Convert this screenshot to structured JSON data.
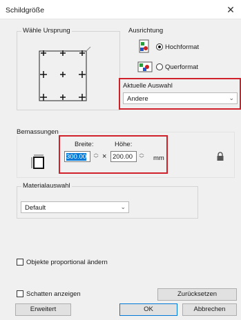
{
  "window": {
    "title": "Schildgröße",
    "close_glyph": "✕"
  },
  "origin": {
    "label": "Wähle Ursprung"
  },
  "orientation": {
    "label": "Ausrichtung",
    "portrait_label": "Hochformat",
    "landscape_label": "Querformat",
    "selected": "Hochformat"
  },
  "current_selection": {
    "label": "Aktuelle Auswahl",
    "value": "Andere"
  },
  "dimensions": {
    "label": "Bemassungen",
    "width_label": "Breite:",
    "width_value": "300.00",
    "times": "×",
    "height_label": "Höhe:",
    "height_value": "200.00",
    "unit": "mm"
  },
  "material": {
    "label": "Materialauswahl",
    "value": "Default"
  },
  "proportional": {
    "label": "Objekte proportional ändern",
    "checked": false
  },
  "shadow": {
    "label": "Schatten anzeigen",
    "checked": false
  },
  "buttons": {
    "reset": "Zurücksetzen",
    "advanced": "Erweitert",
    "ok": "OK",
    "cancel": "Abbrechen"
  },
  "colors": {
    "highlight_border": "#d0202a",
    "selection": "#0078d7"
  }
}
